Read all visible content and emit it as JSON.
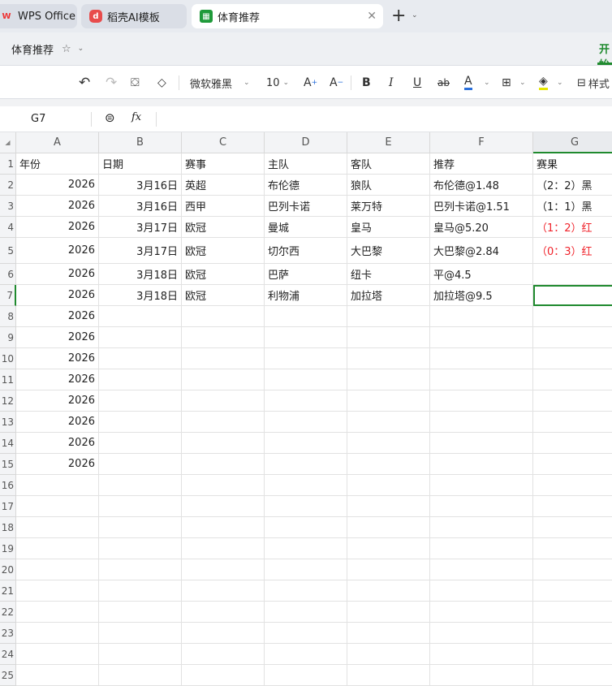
{
  "tabs": [
    {
      "label": "WPS Office",
      "icon": "wps-logo-icon"
    },
    {
      "label": "稻壳AI模板",
      "icon": "docer-icon"
    },
    {
      "label": "体育推荐",
      "icon": "spreadsheet-icon",
      "active": true
    }
  ],
  "doc": {
    "title": "体育推荐",
    "right_tab": "开始"
  },
  "toolbar": {
    "font": "微软雅黑",
    "size": "10",
    "style_label": "样式"
  },
  "formula": {
    "cell_ref": "G7",
    "fx": "fx",
    "value": ""
  },
  "columns": [
    "A",
    "B",
    "C",
    "D",
    "E",
    "F",
    "G"
  ],
  "header_row": [
    "年份",
    "日期",
    "赛事",
    "主队",
    "客队",
    "推荐",
    "赛果"
  ],
  "rows": [
    [
      "2026",
      "3月16日",
      "英超",
      "布伦德",
      "狼队",
      "布伦德@1.48",
      "（2：2）黑"
    ],
    [
      "2026",
      "3月16日",
      "西甲",
      "巴列卡诺",
      "莱万特",
      "巴列卡诺@1.51",
      "（1：1）黑"
    ],
    [
      "2026",
      "3月17日",
      "欧冠",
      "曼城",
      "皇马",
      "皇马@5.20",
      "（1：2）红"
    ],
    [
      "2026",
      "3月17日",
      "欧冠",
      "切尔西",
      "大巴黎",
      "大巴黎@2.84",
      "（0：3）红"
    ],
    [
      "2026",
      "3月18日",
      "欧冠",
      "巴萨",
      "纽卡",
      "平@4.5",
      ""
    ],
    [
      "2026",
      "3月18日",
      "欧冠",
      "利物浦",
      "加拉塔",
      "加拉塔@9.5",
      ""
    ],
    [
      "2026",
      "",
      "",
      "",
      "",
      "",
      ""
    ],
    [
      "2026",
      "",
      "",
      "",
      "",
      "",
      ""
    ],
    [
      "2026",
      "",
      "",
      "",
      "",
      "",
      ""
    ],
    [
      "2026",
      "",
      "",
      "",
      "",
      "",
      ""
    ],
    [
      "2026",
      "",
      "",
      "",
      "",
      "",
      ""
    ],
    [
      "2026",
      "",
      "",
      "",
      "",
      "",
      ""
    ],
    [
      "2026",
      "",
      "",
      "",
      "",
      "",
      ""
    ],
    [
      "2026",
      "",
      "",
      "",
      "",
      "",
      ""
    ]
  ],
  "total_rows": 25,
  "selected_cell": "G7",
  "colors": {
    "accent": "#1f8a2e",
    "red": "#f0232b"
  }
}
